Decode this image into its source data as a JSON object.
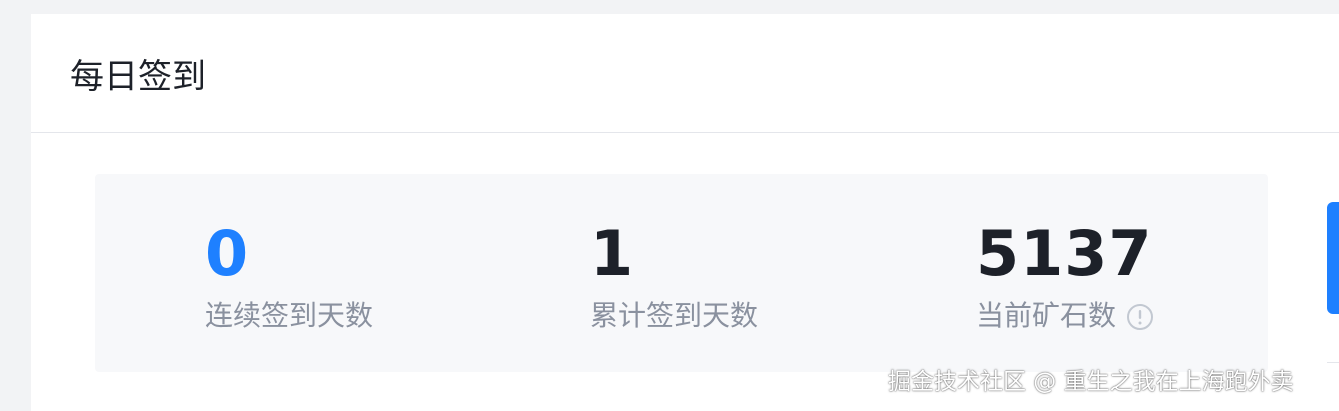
{
  "header": {
    "title": "每日签到"
  },
  "stats": {
    "consecutive": {
      "value": "0",
      "label": "连续签到天数"
    },
    "total": {
      "value": "1",
      "label": "累计签到天数"
    },
    "ore": {
      "value": "5137",
      "label": "当前矿石数",
      "icon": "info-icon"
    }
  },
  "colors": {
    "accent": "#1e80ff",
    "text_primary": "#1d2129",
    "text_secondary": "#8a919f",
    "panel_bg": "#f7f8fa"
  },
  "watermark": {
    "text": "掘金技术社区 @ 重生之我在上海跑外卖"
  }
}
